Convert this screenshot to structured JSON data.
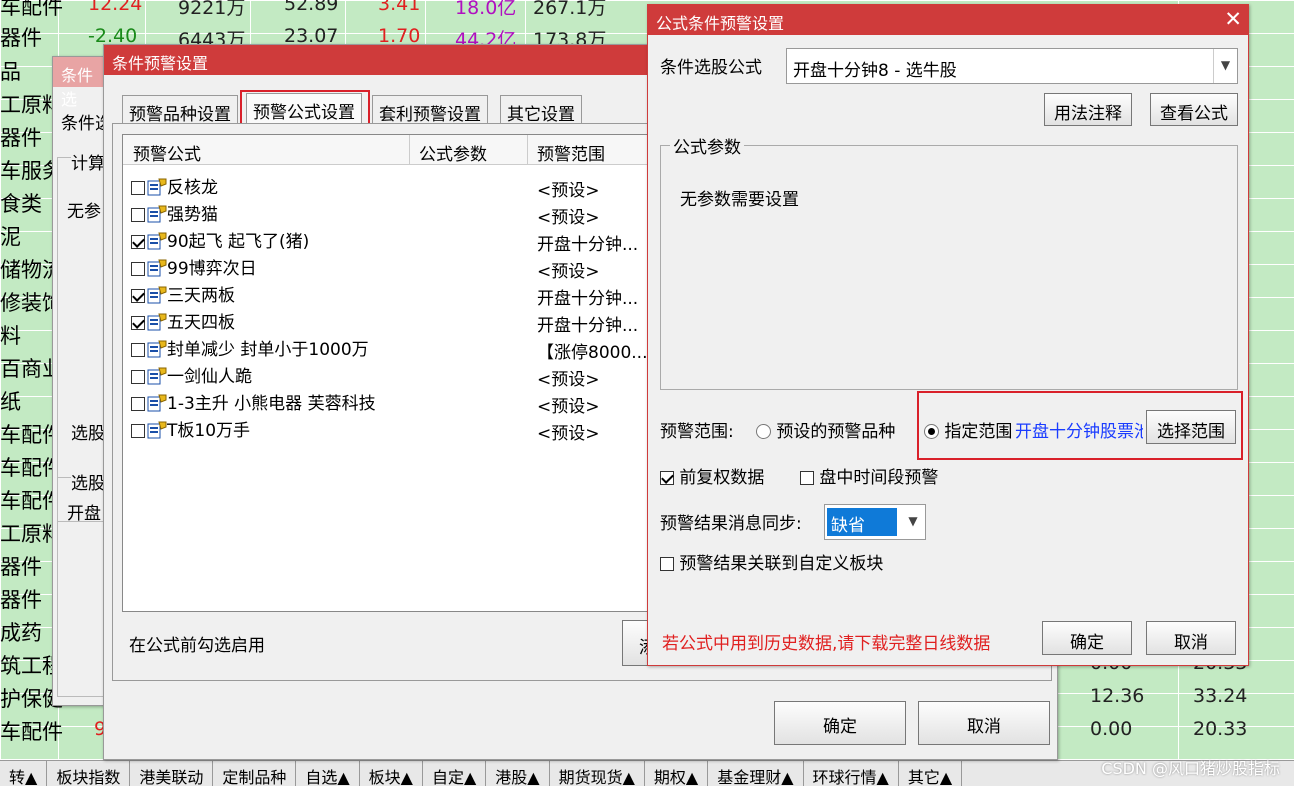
{
  "background": {
    "rows": [
      {
        "name": "车配件",
        "c1": "12.24",
        "c2": "9221万",
        "c3": "52.89",
        "c4": "3.41",
        "c5": "18.0亿",
        "c6": "267.1万"
      },
      {
        "name": "器件",
        "c1": "-2.40",
        "c2": "6443万",
        "c3": "23.07",
        "c4": "1.70",
        "c5": "44.2亿",
        "c6": "173.8万"
      }
    ],
    "left_names": [
      "品",
      "工原料",
      "器件",
      "车服务",
      "食类",
      "泥",
      "储物流",
      "修装饰",
      "料",
      "百商业",
      "纸",
      "车配件",
      "车配件",
      "车配件",
      "工原料",
      "器件",
      "器件",
      "成药",
      "筑工程",
      "护保健",
      "车配件"
    ],
    "right_values": [
      {
        "a": "0.00",
        "b": "20.33"
      },
      {
        "a": "12.36",
        "b": "33.24"
      },
      {
        "a": "0.00",
        "b": "20.33"
      }
    ],
    "red_number_left": "9"
  },
  "bottom_tabs": [
    "转▲",
    "板块指数",
    "港美联动",
    "定制品种",
    "自选▲",
    "板块▲",
    "自定▲",
    "港股▲",
    "期货现货▲",
    "期权▲",
    "基金理财▲",
    "环球行情▲",
    "其它▲"
  ],
  "watermark": "CSDN @风口猪炒股指标",
  "back_window": {
    "title": "条件选",
    "label_formula": "条件选",
    "label_calc": "计算",
    "label_no_param": "无参",
    "label_select": "选股",
    "label_select2": "选股",
    "label_open": "开盘"
  },
  "alert_window": {
    "title": "条件预警设置",
    "tabs": [
      "预警品种设置",
      "预警公式设置",
      "套利预警设置",
      "其它设置"
    ],
    "table_headers": [
      "预警公式",
      "公式参数",
      "预警范围"
    ],
    "formulas": [
      {
        "name": "反核龙",
        "checked": false,
        "range": "<预设>"
      },
      {
        "name": "强势猫",
        "checked": false,
        "range": "<预设>"
      },
      {
        "name": "90起飞 起飞了(猪)",
        "checked": true,
        "range": "开盘十分钟..."
      },
      {
        "name": "99博弈次日",
        "checked": false,
        "range": "<预设>"
      },
      {
        "name": "三天两板",
        "checked": true,
        "range": "开盘十分钟..."
      },
      {
        "name": "五天四板",
        "checked": true,
        "range": "开盘十分钟..."
      },
      {
        "name": "封单减少 封单小于1000万",
        "checked": false,
        "range": "【涨停8000..."
      },
      {
        "name": "一剑仙人跪",
        "checked": false,
        "range": "<预设>"
      },
      {
        "name": "1-3主升 小熊电器 芙蓉科技",
        "checked": false,
        "range": "<预设>"
      },
      {
        "name": "T板10万手",
        "checked": false,
        "range": "<预设>"
      }
    ],
    "hint": "在公式前勾选启用",
    "partial_button": "添",
    "ok": "确定",
    "cancel": "取消"
  },
  "formula_dialog": {
    "title": "公式条件预警设置",
    "formula_label": "条件选股公式",
    "formula_value": "开盘十分钟8  -  选牛股",
    "usage_button": "用法注释",
    "view_button": "查看公式",
    "params_group": "公式参数",
    "no_params": "无参数需要设置",
    "range_label": "预警范围:",
    "radio_preset": "预设的预警品种",
    "radio_specified": "指定范围",
    "range_value": "开盘十分钟股票池",
    "select_range_button": "选择范围",
    "check_adjusted": "前复权数据",
    "check_adjusted_on": true,
    "check_intraday": "盘中时间段预警",
    "check_intraday_on": false,
    "sync_label": "预警结果消息同步:",
    "sync_value": "缺省",
    "check_link": "预警结果关联到自定义板块",
    "warning": "若公式中用到历史数据,请下载完整日线数据",
    "ok": "确定",
    "cancel": "取消",
    "colors": {
      "title": "#cf3b3b",
      "warning": "#e02020",
      "link": "#1a3cff"
    }
  }
}
